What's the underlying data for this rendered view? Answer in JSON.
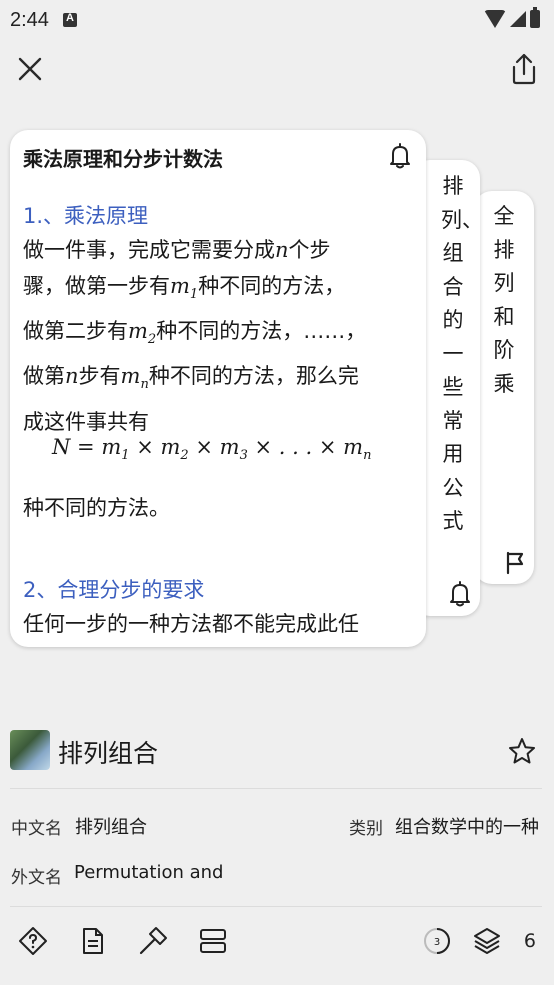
{
  "status_bar": {
    "time": "2:44"
  },
  "cards": {
    "main": {
      "title": "乘法原理和分步计数法",
      "section1_heading": "1.、乘法原理",
      "p1_line1_a": "做一件事，完成它需要分成",
      "p1_line1_var": "n",
      "p1_line1_b": "个步",
      "p1_line2_a": "骤，做第一步有",
      "p1_line2_var": "m",
      "p1_line2_sub": "1",
      "p1_line2_b": "种不同的方法，",
      "p1_line3_a": "做第二步有",
      "p1_line3_var": "m",
      "p1_line3_sub": "2",
      "p1_line3_b": "种不同的方法，……，",
      "p1_line4_a": "做第",
      "p1_line4_var1": "n",
      "p1_line4_b": "步有",
      "p1_line4_var2": "m",
      "p1_line4_sub": "n",
      "p1_line4_c": "种不同的方法，那么完",
      "p1_line5": "成这件事共有",
      "formula": {
        "N": "N",
        "eq": " = ",
        "m": "m",
        "s1": "1",
        "s2": "2",
        "s3": "3",
        "sn": "n",
        "times": " × ",
        "dots": " . . . "
      },
      "p2": "种不同的方法。",
      "section2_heading": "2、合理分步的要求",
      "p3": "任何一步的一种方法都不能完成此任"
    },
    "second": {
      "title": "排列、组合的一些常用公式"
    },
    "third": {
      "title": "全排列和阶乘"
    }
  },
  "entry": {
    "title": "排列组合",
    "fields": {
      "chinese_name_label": "中文名",
      "chinese_name_value": "排列组合",
      "category_label": "类别",
      "category_value": "组合数学中的一种",
      "foreign_name_label": "外文名",
      "foreign_name_value": "Permutation and"
    }
  },
  "bottom_bar": {
    "progress_badge": "3",
    "layer_count": "6"
  },
  "colors": {
    "accent_blue": "#3c5fbf",
    "background": "#efefef",
    "card": "#ffffff"
  },
  "icons": [
    "close-icon",
    "share-icon",
    "bell-icon",
    "flag-icon",
    "star-icon",
    "question-diamond-icon",
    "document-icon",
    "hammer-icon",
    "cards-icon",
    "progress-circle-icon",
    "layers-icon"
  ]
}
